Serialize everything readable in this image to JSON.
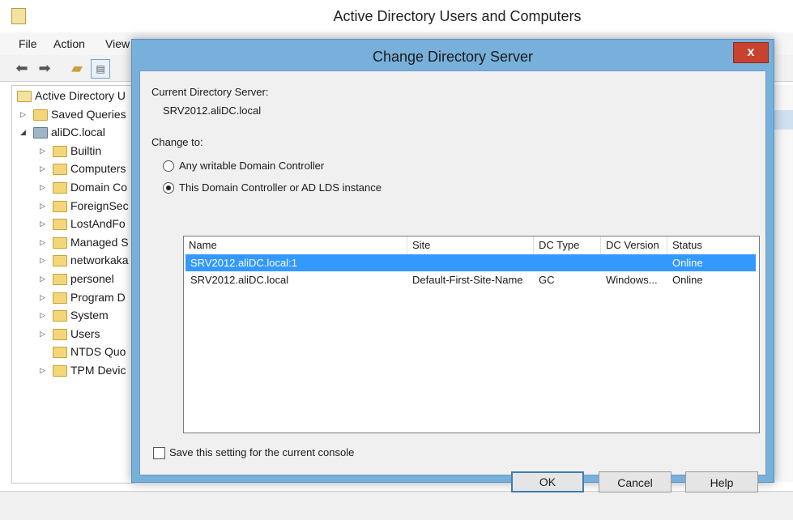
{
  "main_window": {
    "title": "Active Directory Users and Computers",
    "menu": [
      "File",
      "Action",
      "View"
    ],
    "tree": [
      {
        "label": "Active Directory U",
        "level": 0,
        "expander": "",
        "icon": "ad-root-icon"
      },
      {
        "label": "Saved Queries",
        "level": 1,
        "expander": "▷",
        "icon": "folder-icon"
      },
      {
        "label": "aliDC.local",
        "level": 1,
        "expander": "◢",
        "icon": "domain-icon"
      },
      {
        "label": "Builtin",
        "level": 2,
        "expander": "▷",
        "icon": "folder-icon"
      },
      {
        "label": "Computers",
        "level": 2,
        "expander": "▷",
        "icon": "folder-icon"
      },
      {
        "label": "Domain Co",
        "level": 2,
        "expander": "▷",
        "icon": "ou-folder-icon"
      },
      {
        "label": "ForeignSec",
        "level": 2,
        "expander": "▷",
        "icon": "folder-icon"
      },
      {
        "label": "LostAndFo",
        "level": 2,
        "expander": "▷",
        "icon": "folder-icon"
      },
      {
        "label": "Managed S",
        "level": 2,
        "expander": "▷",
        "icon": "folder-icon"
      },
      {
        "label": "networkaka",
        "level": 2,
        "expander": "▷",
        "icon": "ou-folder-icon"
      },
      {
        "label": "personel",
        "level": 2,
        "expander": "▷",
        "icon": "ou-folder-icon"
      },
      {
        "label": "Program D",
        "level": 2,
        "expander": "▷",
        "icon": "folder-icon"
      },
      {
        "label": "System",
        "level": 2,
        "expander": "▷",
        "icon": "folder-icon"
      },
      {
        "label": "Users",
        "level": 2,
        "expander": "▷",
        "icon": "folder-icon"
      },
      {
        "label": "NTDS Quo",
        "level": 2,
        "expander": "",
        "icon": "folder-icon"
      },
      {
        "label": "TPM Devic",
        "level": 2,
        "expander": "▷",
        "icon": "folder-icon"
      }
    ]
  },
  "dialog": {
    "title": "Change Directory Server",
    "close_label": "x",
    "current_label": "Current Directory Server:",
    "current_value": "SRV2012.aliDC.local",
    "change_to_label": "Change to:",
    "option_any": "Any writable Domain Controller",
    "option_this": "This Domain Controller or AD LDS instance",
    "selected_option": "this",
    "columns": [
      "Name",
      "Site",
      "DC Type",
      "DC Version",
      "Status"
    ],
    "rows": [
      {
        "name": "SRV2012.aliDC.local:1",
        "site": "",
        "dc_type": "",
        "dc_version": "",
        "status": "Online",
        "selected": true
      },
      {
        "name": "SRV2012.aliDC.local",
        "site": "Default-First-Site-Name",
        "dc_type": "GC",
        "dc_version": "Windows...",
        "status": "Online",
        "selected": false
      }
    ],
    "save_setting_label": "Save this setting for the current console",
    "save_setting_checked": false,
    "ok_label": "OK",
    "cancel_label": "Cancel",
    "help_label": "Help"
  },
  "colors": {
    "dialog_frame": "#78b0dc",
    "selection": "#3399ff",
    "close_button": "#c7432f"
  }
}
